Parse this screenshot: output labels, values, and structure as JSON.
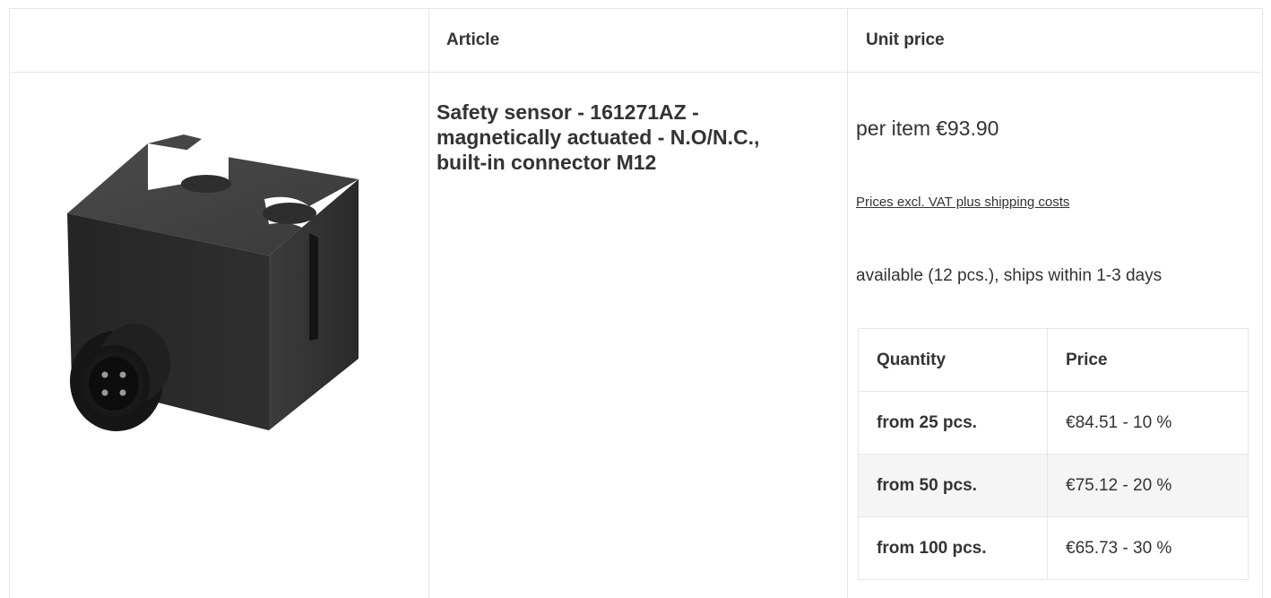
{
  "table": {
    "headers": {
      "image": "",
      "article": "Article",
      "unit_price": "Unit price"
    }
  },
  "product": {
    "image_icon": "safety-sensor-product-image",
    "title": "Safety sensor - 161271AZ - magnetically actuated - N.O/N.C., built-in connector M12",
    "price_prefix": "per item",
    "price": "€93.90",
    "price_note": "Prices excl. VAT plus shipping costs ",
    "availability": "available (12 pcs.), ships within 1-3 days"
  },
  "tiers": {
    "headers": [
      "Quantity",
      "Price"
    ],
    "rows": [
      {
        "quantity": "from 25 pcs.",
        "price": "€84.51 - 10 %"
      },
      {
        "quantity": "from 50 pcs.",
        "price": "€75.12 - 20 %"
      },
      {
        "quantity": "from 100 pcs.",
        "price": "€65.73 - 30 %"
      }
    ]
  },
  "colors": {
    "border": "#e6e6e6",
    "text": "#333333",
    "alt_row": "#f5f5f5",
    "product_body": "#2b2b2b"
  }
}
